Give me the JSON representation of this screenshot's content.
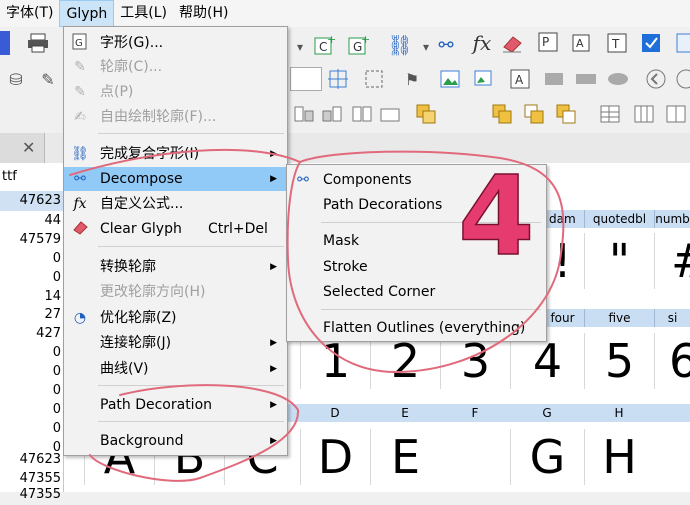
{
  "menubar": {
    "items": [
      "字体(T)",
      "Glyph",
      "工具(L)",
      "帮助(H)"
    ]
  },
  "left_panel": {
    "tab_header": "ttf",
    "values": [
      "47623",
      "44",
      "47579",
      "0",
      "0",
      "14",
      "27",
      "427",
      "0",
      "0",
      "0",
      "0",
      "0",
      "0",
      "47623",
      "47355",
      "47355"
    ]
  },
  "glyph_menu": {
    "items": [
      {
        "label": "字形(G)...",
        "icon": "glyph-icon"
      },
      {
        "label": "轮廓(C)...",
        "icon": "outline-pen-icon",
        "disabled": true
      },
      {
        "label": "点(P)",
        "icon": "point-pen-icon",
        "disabled": true
      },
      {
        "label": "自由绘制轮廓(F)...",
        "icon": "freehand-pen-icon",
        "disabled": true
      },
      {
        "label": "完成复合字形(I)",
        "icon": "link-icon"
      },
      {
        "label": "Decompose",
        "icon": "broken-link-icon"
      },
      {
        "label": "自定义公式...",
        "icon": "fx-icon"
      },
      {
        "label": "Clear Glyph",
        "shortcut": "Ctrl+Del",
        "icon": "eraser-icon"
      },
      {
        "label": "转换轮廓"
      },
      {
        "label": "更改轮廓方向(H)",
        "disabled": true
      },
      {
        "label": "优化轮廓(Z)",
        "icon": "optimize-icon"
      },
      {
        "label": "连接轮廓(J)"
      },
      {
        "label": "曲线(V)"
      },
      {
        "label": "Path Decoration"
      },
      {
        "label": "Background"
      }
    ]
  },
  "decompose_submenu": {
    "items": [
      "Components",
      "Path Decorations",
      "Mask",
      "Stroke",
      "Selected Corner",
      "Flatten Outlines (everything)"
    ]
  },
  "grid": {
    "row1_headers": [
      "dam",
      "quotedbl",
      "numb"
    ],
    "row1_glyphs": [
      "!",
      "\"",
      "#"
    ],
    "row2_headers": [
      "four",
      "five",
      "si"
    ],
    "row2_glyphs": [
      "1",
      "2",
      "3",
      "4",
      "5",
      "6"
    ],
    "row3_headers": [
      "D",
      "E",
      "F",
      "G",
      "H"
    ],
    "row3_glyphs": [
      "A",
      "B",
      "C",
      "D",
      "E",
      "G",
      "H"
    ]
  },
  "annotation": {
    "number": "4",
    "color": "#e63b6e"
  }
}
